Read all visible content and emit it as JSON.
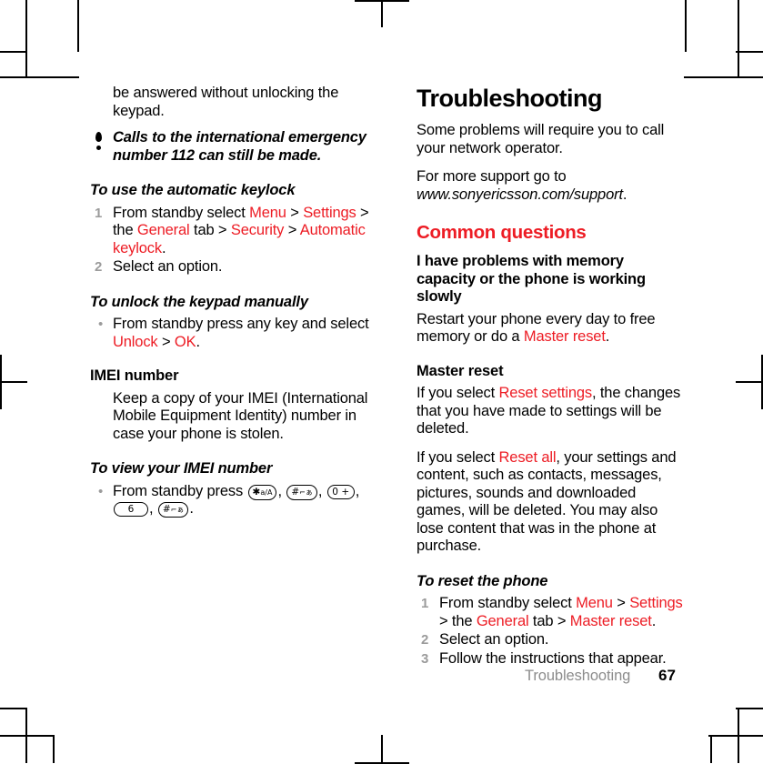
{
  "document": {
    "page_number": "67",
    "footer_chapter": "Troubleshooting"
  },
  "left_column": {
    "continued_paragraph": "be answered without unlocking the keypad.",
    "note": {
      "icon": "exclamation-icon",
      "text": "Calls to the international emergency number 112 can still be made."
    },
    "task_keylock": {
      "title": "To use the automatic keylock",
      "step1": {
        "num": "1",
        "part1": "From standby select ",
        "link1": "Menu",
        "sep1": " > ",
        "link2": "Settings",
        "sep2": " > the ",
        "link3": "General",
        "sep3": " tab > ",
        "link4": "Security",
        "sep4": " > ",
        "link5": "Automatic keylock",
        "end": "."
      },
      "step2": {
        "num": "2",
        "text": "Select an option."
      }
    },
    "task_unlock": {
      "title": "To unlock the keypad manually",
      "bullet": "•",
      "part1": "From standby press any key and select ",
      "link1": "Unlock",
      "sep1": " > ",
      "link2": "OK",
      "end": "."
    },
    "imei": {
      "heading": "IMEI number",
      "body": "Keep a copy of your IMEI (International Mobile Equipment Identity) number in case your phone is stolen."
    },
    "task_imei": {
      "title": "To view your IMEI number",
      "bullet": "•",
      "lead": "From standby press ",
      "keys": [
        {
          "name": "star-key",
          "main": "✱",
          "sub": "a/A"
        },
        {
          "name": "hash-key",
          "main": "#",
          "sub": "⌐ぁ"
        },
        {
          "name": "zero-key",
          "main": "0",
          "sub": "+"
        },
        {
          "name": "six-key",
          "main": "6",
          "sub": ""
        },
        {
          "name": "hash-key",
          "main": "#",
          "sub": "⌐ぁ"
        }
      ],
      "comma": ", ",
      "end": "."
    }
  },
  "right_column": {
    "chapter_title": "Troubleshooting",
    "intro1": "Some problems will require you to call your network operator.",
    "intro2_lead": "For more support go to ",
    "intro2_url": "www.sonyericsson.com/support",
    "intro2_end": ".",
    "section_title": "Common questions",
    "memory_q": {
      "question": "I have problems with memory capacity or the phone is working slowly",
      "answer_part1": "Restart your phone every day to free memory or do a ",
      "answer_link": "Master reset",
      "answer_end": "."
    },
    "master_reset": {
      "heading": "Master reset",
      "p1_part1": "If you select ",
      "p1_link": "Reset settings",
      "p1_part2": ", the changes that you have made to settings will be deleted.",
      "p2_part1": "If you select ",
      "p2_link": "Reset all",
      "p2_part2": ", your settings and content, such as contacts, messages, pictures, sounds and downloaded games, will be deleted. You may also lose content that was in the phone at purchase."
    },
    "task_reset": {
      "title": "To reset the phone",
      "step1": {
        "num": "1",
        "part1": "From standby select ",
        "link1": "Menu",
        "sep1": " > ",
        "link2": "Settings",
        "sep2": " > the ",
        "link3": "General",
        "sep3": " tab > ",
        "link4": "Master reset",
        "end": "."
      },
      "step2": {
        "num": "2",
        "text": "Select an option."
      },
      "step3": {
        "num": "3",
        "text": "Follow the instructions that appear."
      }
    }
  },
  "colors": {
    "link_red": "#ED1C24",
    "marker_gray": "#9b9b9b",
    "footer_gray": "#8c8c8c"
  }
}
